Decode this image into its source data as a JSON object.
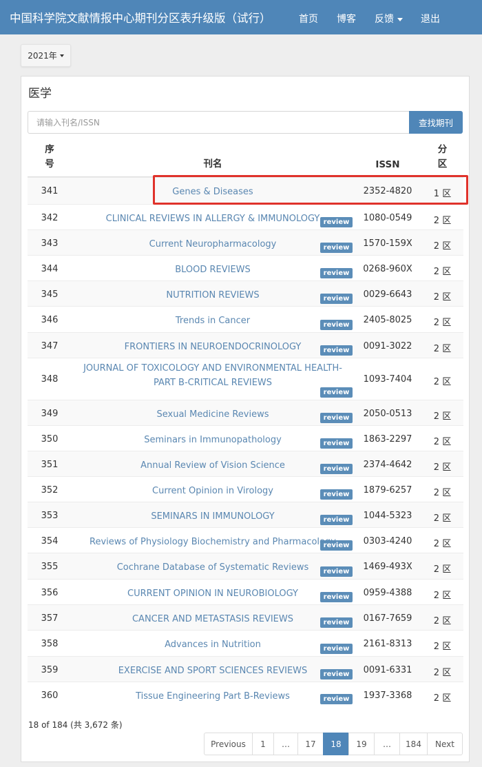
{
  "header": {
    "title": "中国科学院文献情报中心期刊分区表升级版（试行）",
    "nav": [
      {
        "label": "首页"
      },
      {
        "label": "博客"
      },
      {
        "label": "反馈",
        "dropdown": true
      },
      {
        "label": "退出"
      }
    ],
    "bg_color": "#4f86b8"
  },
  "year_selector": {
    "value": "2021年"
  },
  "panel": {
    "title": "医学",
    "search": {
      "placeholder": "请输入刊名/ISSN",
      "button_label": "查找期刊"
    }
  },
  "table": {
    "columns": {
      "no_line1": "序",
      "no_line2": "号",
      "name": "刊名",
      "issn": "ISSN",
      "zone_line1": "分",
      "zone_line2": "区"
    },
    "badge_label": "review",
    "rows": [
      {
        "no": "341",
        "name": "Genes & Diseases",
        "issn": "2352-4820",
        "zone": "1 区",
        "review": false,
        "highlighted": true
      },
      {
        "no": "342",
        "name": "CLINICAL REVIEWS IN ALLERGY & IMMUNOLOGY",
        "issn": "1080-0549",
        "zone": "2 区",
        "review": true
      },
      {
        "no": "343",
        "name": "Current Neuropharmacology",
        "issn": "1570-159X",
        "zone": "2 区",
        "review": true
      },
      {
        "no": "344",
        "name": "BLOOD REVIEWS",
        "issn": "0268-960X",
        "zone": "2 区",
        "review": true
      },
      {
        "no": "345",
        "name": "NUTRITION REVIEWS",
        "issn": "0029-6643",
        "zone": "2 区",
        "review": true
      },
      {
        "no": "346",
        "name": "Trends in Cancer",
        "issn": "2405-8025",
        "zone": "2 区",
        "review": true
      },
      {
        "no": "347",
        "name": "FRONTIERS IN NEUROENDOCRINOLOGY",
        "issn": "0091-3022",
        "zone": "2 区",
        "review": true
      },
      {
        "no": "348",
        "name": "JOURNAL OF TOXICOLOGY AND ENVIRONMENTAL HEALTH-PART B-CRITICAL REVIEWS",
        "issn": "1093-7404",
        "zone": "2 区",
        "review": true
      },
      {
        "no": "349",
        "name": "Sexual Medicine Reviews",
        "issn": "2050-0513",
        "zone": "2 区",
        "review": true
      },
      {
        "no": "350",
        "name": "Seminars in Immunopathology",
        "issn": "1863-2297",
        "zone": "2 区",
        "review": true
      },
      {
        "no": "351",
        "name": "Annual Review of Vision Science",
        "issn": "2374-4642",
        "zone": "2 区",
        "review": true
      },
      {
        "no": "352",
        "name": "Current Opinion in Virology",
        "issn": "1879-6257",
        "zone": "2 区",
        "review": true
      },
      {
        "no": "353",
        "name": "SEMINARS IN IMMUNOLOGY",
        "issn": "1044-5323",
        "zone": "2 区",
        "review": true
      },
      {
        "no": "354",
        "name": "Reviews of Physiology Biochemistry and Pharmacology",
        "issn": "0303-4240",
        "zone": "2 区",
        "review": true
      },
      {
        "no": "355",
        "name": "Cochrane Database of Systematic Reviews",
        "issn": "1469-493X",
        "zone": "2 区",
        "review": true
      },
      {
        "no": "356",
        "name": "CURRENT OPINION IN NEUROBIOLOGY",
        "issn": "0959-4388",
        "zone": "2 区",
        "review": true
      },
      {
        "no": "357",
        "name": "CANCER AND METASTASIS REVIEWS",
        "issn": "0167-7659",
        "zone": "2 区",
        "review": true
      },
      {
        "no": "358",
        "name": "Advances in Nutrition",
        "issn": "2161-8313",
        "zone": "2 区",
        "review": true
      },
      {
        "no": "359",
        "name": "EXERCISE AND SPORT SCIENCES REVIEWS",
        "issn": "0091-6331",
        "zone": "2 区",
        "review": true
      },
      {
        "no": "360",
        "name": "Tissue Engineering Part B-Reviews",
        "issn": "1937-3368",
        "zone": "2 区",
        "review": true
      }
    ]
  },
  "pagination": {
    "summary": "18 of 184 (共 3,672 条)",
    "items": [
      {
        "label": "Previous"
      },
      {
        "label": "1"
      },
      {
        "label": "…"
      },
      {
        "label": "17"
      },
      {
        "label": "18",
        "active": true
      },
      {
        "label": "19"
      },
      {
        "label": "…"
      },
      {
        "label": "184"
      },
      {
        "label": "Next"
      }
    ]
  }
}
